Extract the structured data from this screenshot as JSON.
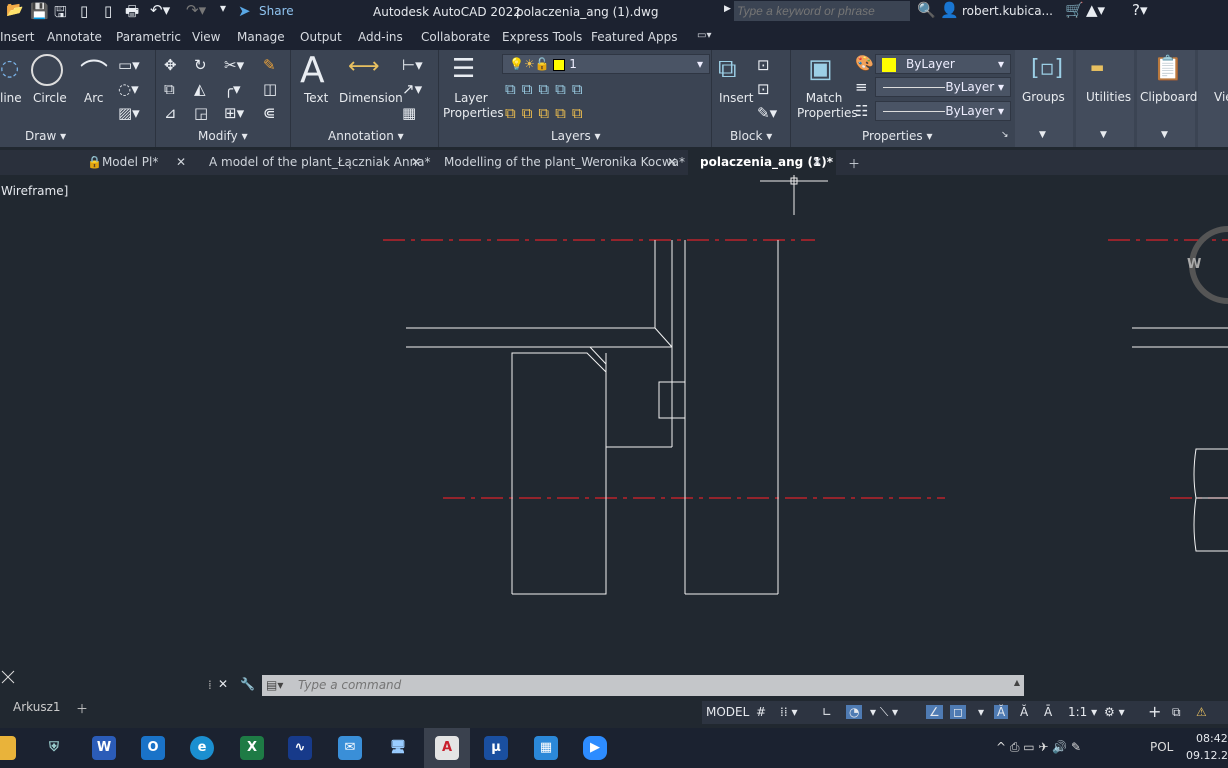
{
  "titlebar": {
    "app": "Autodesk AutoCAD 2022",
    "file": "polaczenia_ang (1).dwg",
    "share": "Share",
    "search_placeholder": "Type a keyword or phrase",
    "user": "robert.kubica..."
  },
  "menu": [
    "Insert",
    "Annotate",
    "Parametric",
    "View",
    "Manage",
    "Output",
    "Add-ins",
    "Collaborate",
    "Express Tools",
    "Featured Apps"
  ],
  "ribbon": {
    "draw": {
      "title": "Draw",
      "items": [
        "line",
        "Circle",
        "Arc"
      ]
    },
    "modify": {
      "title": "Modify"
    },
    "annotation": {
      "title": "Annotation",
      "items": [
        "Text",
        "Dimension"
      ]
    },
    "layers": {
      "title": "Layers",
      "layer_props": "Layer Properties",
      "current_layer": "1"
    },
    "block": {
      "title": "Block",
      "insert": "Insert"
    },
    "properties": {
      "title": "Properties",
      "match": "Match Properties",
      "color": "ByLayer",
      "linetype": "ByLayer",
      "lineweight": "ByLayer"
    },
    "groups": "Groups",
    "utilities": "Utilities",
    "clipboard": "Clipboard",
    "view": "Vie"
  },
  "doc_tabs": [
    {
      "label": "Model Pl*",
      "locked": true
    },
    {
      "label": "A model of the plant_Łączniak Anna*"
    },
    {
      "label": "Modelling of the plant_Weronika Kocwa*"
    },
    {
      "label": "polaczenia_ang (1)*",
      "active": true
    }
  ],
  "viewport_label": "Wireframe]",
  "viewcube_label": "W",
  "command": {
    "placeholder": "Type a command"
  },
  "layout_tabs": [
    "Arkusz1"
  ],
  "status": {
    "model": "MODEL",
    "scale": "1:1"
  },
  "tray": {
    "lang": "POL",
    "time": "08:42",
    "date": "09.12.20"
  },
  "colors": {
    "accent": "#4f7bb3",
    "layer_yellow": "#ffff00",
    "centerline": "#d9232a"
  }
}
